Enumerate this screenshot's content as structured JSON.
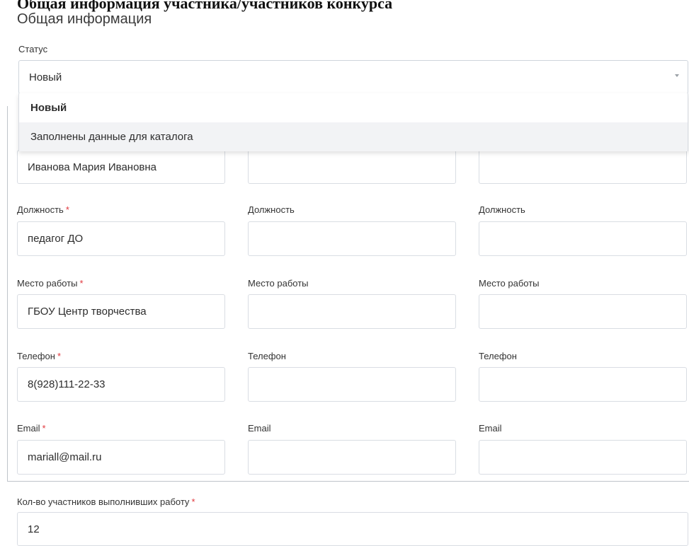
{
  "top_cut_text": "Общая информация участника/участников конкурса",
  "section_title": "Общая информация",
  "status": {
    "label": "Статус",
    "value": "Новый",
    "options": [
      "Новый",
      "Заполнены данные для каталога"
    ]
  },
  "required_mark": "*",
  "participants": [
    {
      "name": "Иванова Мария Ивановна",
      "position_label": "Должность",
      "position": "педагог ДО",
      "workplace_label": "Место работы",
      "workplace": "ГБОУ Центр творчества",
      "phone_label": "Телефон",
      "phone": "8(928)111-22-33",
      "email_label": "Email",
      "email": "mariall@mail.ru"
    },
    {
      "name": "",
      "position_label": "Должность",
      "position": "",
      "workplace_label": "Место работы",
      "workplace": "",
      "phone_label": "Телефон",
      "phone": "",
      "email_label": "Email",
      "email": ""
    },
    {
      "name": "",
      "position_label": "Должность",
      "position": "",
      "workplace_label": "Место работы",
      "workplace": "",
      "phone_label": "Телефон",
      "phone": "",
      "email_label": "Email",
      "email": ""
    }
  ],
  "participants_count": {
    "label": "Кол-во участников выполнивших работу",
    "value": "12"
  }
}
